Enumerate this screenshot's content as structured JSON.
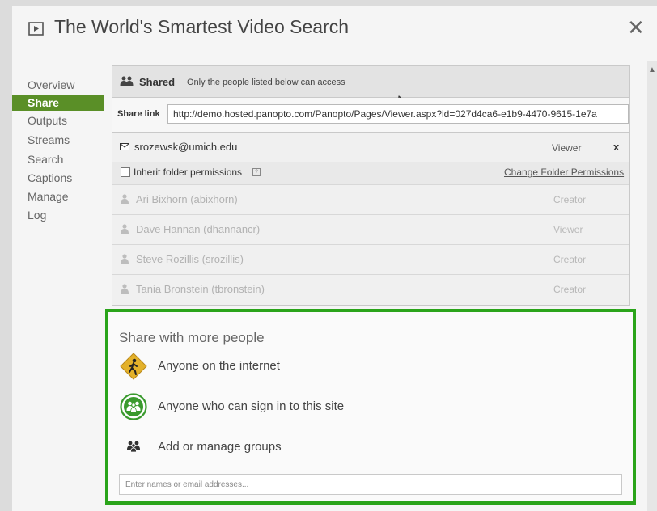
{
  "dialog": {
    "title": "The World's Smartest Video Search",
    "close_label": "✕"
  },
  "nav": {
    "items": [
      {
        "label": "Overview"
      },
      {
        "label": "Share"
      },
      {
        "label": "Outputs"
      },
      {
        "label": "Streams"
      },
      {
        "label": "Search"
      },
      {
        "label": "Captions"
      },
      {
        "label": "Manage"
      },
      {
        "label": "Log"
      }
    ],
    "active": "Share"
  },
  "sharing": {
    "status_label": "Shared",
    "status_desc": "Only the people listed below can access",
    "link_label": "Share link",
    "link_value": "http://demo.hosted.panopto.com/Panopto/Pages/Viewer.aspx?id=027d4ca6-e1b9-4470-9615-1e7a",
    "user": {
      "email": "srozewsk@umich.edu",
      "role": "Viewer",
      "remove": "x"
    },
    "inherit_label": "Inherit folder permissions",
    "info_glyph": "?",
    "change_folder_link": "Change Folder Permissions",
    "members": [
      {
        "name": "Ari Bixhorn (abixhorn)",
        "role": "Creator"
      },
      {
        "name": "Dave Hannan (dhannancr)",
        "role": "Viewer"
      },
      {
        "name": "Steve Rozillis (srozillis)",
        "role": "Creator"
      },
      {
        "name": "Tania Bronstein (tbronstein)",
        "role": "Creator"
      }
    ]
  },
  "share_more": {
    "heading": "Share with more people",
    "options": [
      {
        "label": "Anyone on the internet",
        "icon": "public-walker-icon"
      },
      {
        "label": "Anyone who can sign in to this site",
        "icon": "signed-in-group-icon"
      },
      {
        "label": "Add or manage groups",
        "icon": "groups-icon"
      }
    ],
    "input_placeholder": "Enter names or email addresses..."
  },
  "colors": {
    "accent_green": "#5a8f27",
    "highlight_green": "#2aa41a",
    "public_yellow": "#e3b12a"
  }
}
